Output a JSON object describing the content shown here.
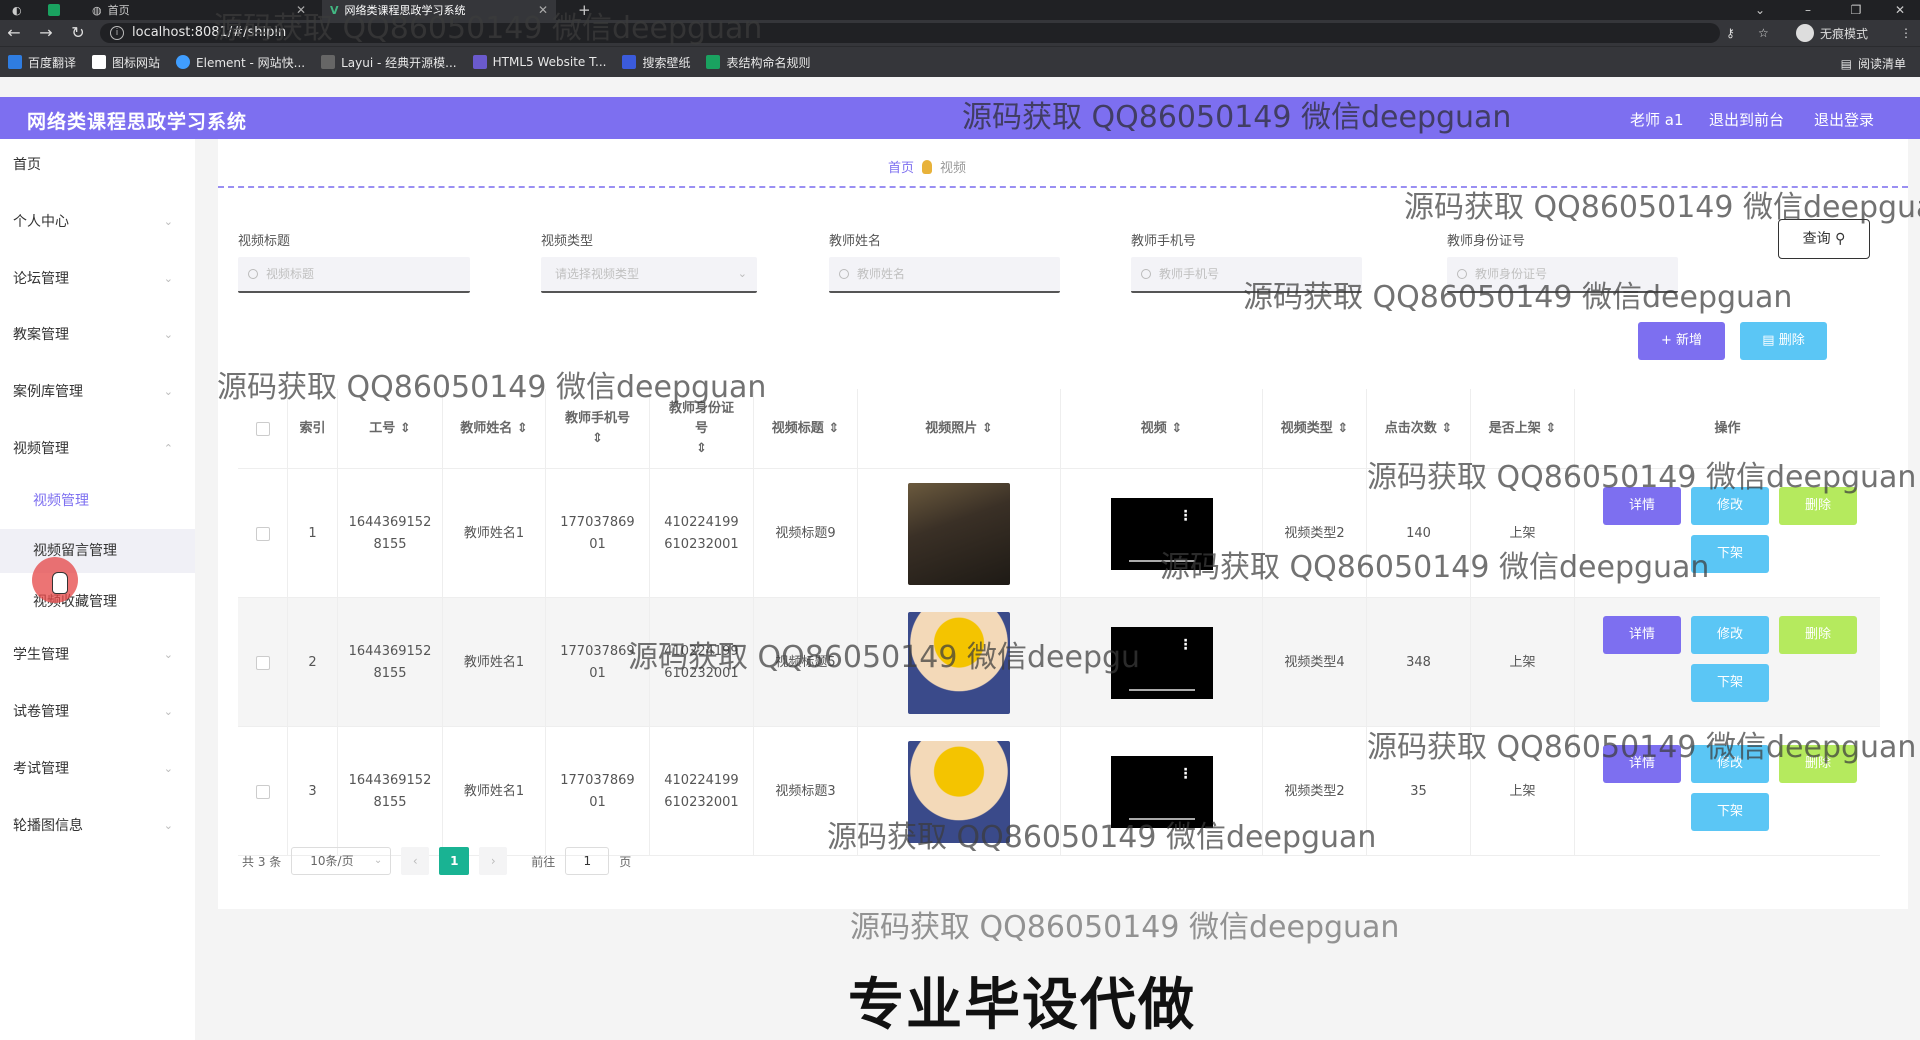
{
  "browser": {
    "tabs": [
      {
        "label": "首页"
      },
      {
        "label": "网络类课程思政学习系统"
      }
    ],
    "new_tab": "+",
    "url": "localhost:8081/#/shipin",
    "profile": "无痕模式",
    "bookmarks": [
      "百度翻译",
      "图标网站",
      "Element - 网站快...",
      "Layui - 经典开源模...",
      "HTML5 Website T...",
      "搜索壁纸",
      "表结构命名规则"
    ],
    "reading_list": "阅读清单"
  },
  "header": {
    "title": "网络类课程思政学习系统",
    "user": "老师 a1",
    "to_front": "退出到前台",
    "logout": "退出登录"
  },
  "sidebar": {
    "items": [
      {
        "label": "首页"
      },
      {
        "label": "个人中心"
      },
      {
        "label": "论坛管理"
      },
      {
        "label": "教案管理"
      },
      {
        "label": "案例库管理"
      },
      {
        "label": "视频管理"
      },
      {
        "label": "学生管理"
      },
      {
        "label": "试卷管理"
      },
      {
        "label": "考试管理"
      },
      {
        "label": "轮播图信息"
      }
    ],
    "sub_items": [
      {
        "label": "视频管理"
      },
      {
        "label": "视频留言管理"
      },
      {
        "label": "视频收藏管理"
      }
    ]
  },
  "breadcrumb": {
    "home": "首页",
    "current": "视频"
  },
  "filters": [
    {
      "label": "视频标题",
      "placeholder": "视频标题"
    },
    {
      "label": "视频类型",
      "placeholder": "请选择视频类型"
    },
    {
      "label": "教师姓名",
      "placeholder": "教师姓名"
    },
    {
      "label": "教师手机号",
      "placeholder": "教师手机号"
    },
    {
      "label": "教师身份证号",
      "placeholder": "教师身份证号"
    }
  ],
  "buttons": {
    "query": "查询",
    "add": "+ 新增",
    "delete": "删除"
  },
  "table": {
    "columns": [
      "索引",
      "工号",
      "教师姓名",
      "教师手机号",
      "教师身份证号",
      "视频标题",
      "视频照片",
      "视频",
      "视频类型",
      "点击次数",
      "是否上架",
      "操作"
    ],
    "rows": [
      {
        "index": "1",
        "id_line1": "1644369152",
        "id_line2": "8155",
        "teacher": "教师姓名1",
        "phone_line1": "177037869",
        "phone_line2": "01",
        "idcard_line1": "410224199",
        "idcard_line2": "610232001",
        "title": "视频标题9",
        "type": "视频类型2",
        "clicks": "140",
        "status": "上架"
      },
      {
        "index": "2",
        "id_line1": "1644369152",
        "id_line2": "8155",
        "teacher": "教师姓名1",
        "phone_line1": "177037869",
        "phone_line2": "01",
        "idcard_line1": "410224199",
        "idcard_line2": "610232001",
        "title": "视频标题5",
        "type": "视频类型4",
        "clicks": "348",
        "status": "上架"
      },
      {
        "index": "3",
        "id_line1": "1644369152",
        "id_line2": "8155",
        "teacher": "教师姓名1",
        "phone_line1": "177037869",
        "phone_line2": "01",
        "idcard_line1": "410224199",
        "idcard_line2": "610232001",
        "title": "视频标题3",
        "type": "视频类型2",
        "clicks": "35",
        "status": "上架"
      }
    ],
    "actions": {
      "detail": "详情",
      "edit": "修改",
      "delete": "删除",
      "offshelf": "下架"
    }
  },
  "pagination": {
    "total": "共 3 条",
    "page_size": "10条/页",
    "current_page": "1",
    "goto_label": "前往",
    "goto_value": "1",
    "page_suffix": "页"
  },
  "overlay": {
    "watermark": "源码获取 QQ86050149 微信deepguan",
    "watermark_cut": "源码获取 QQ86050149 微信deepgua",
    "watermark_cut2": "源码获取 QQ86050149 微信deepgu",
    "watermark_cut3": "源码获取 QQ86050149 微信deepguan",
    "caption": "专业毕设代做"
  },
  "colors": {
    "primary": "#7d6ff0",
    "info": "#5bc6f5",
    "success": "#b5ea5e",
    "pager_active": "#19b393"
  }
}
